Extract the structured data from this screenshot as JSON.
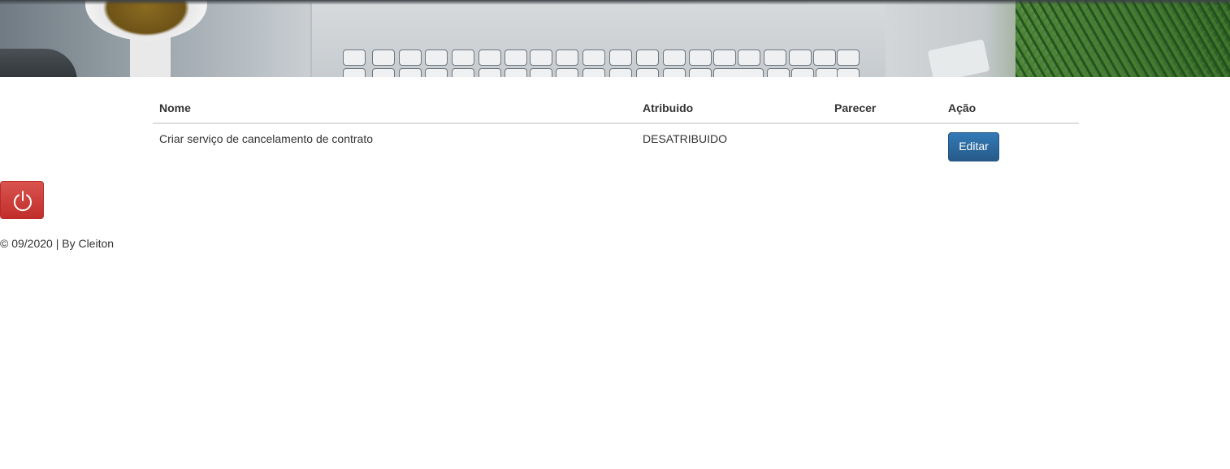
{
  "table": {
    "headers": {
      "nome": "Nome",
      "atribuido": "Atribuido",
      "parecer": "Parecer",
      "acao": "Ação"
    },
    "rows": [
      {
        "nome": "Criar serviço de cancelamento de contrato",
        "atribuido": "DESATRIBUIDO",
        "parecer": "",
        "acao_label": "Editar"
      }
    ]
  },
  "logout": {
    "icon": "power-icon",
    "color": "#d9534f"
  },
  "footer": {
    "text": "© 09/2020 | By Cleiton"
  },
  "colors": {
    "primary": "#337ab7",
    "danger": "#d9534f"
  }
}
